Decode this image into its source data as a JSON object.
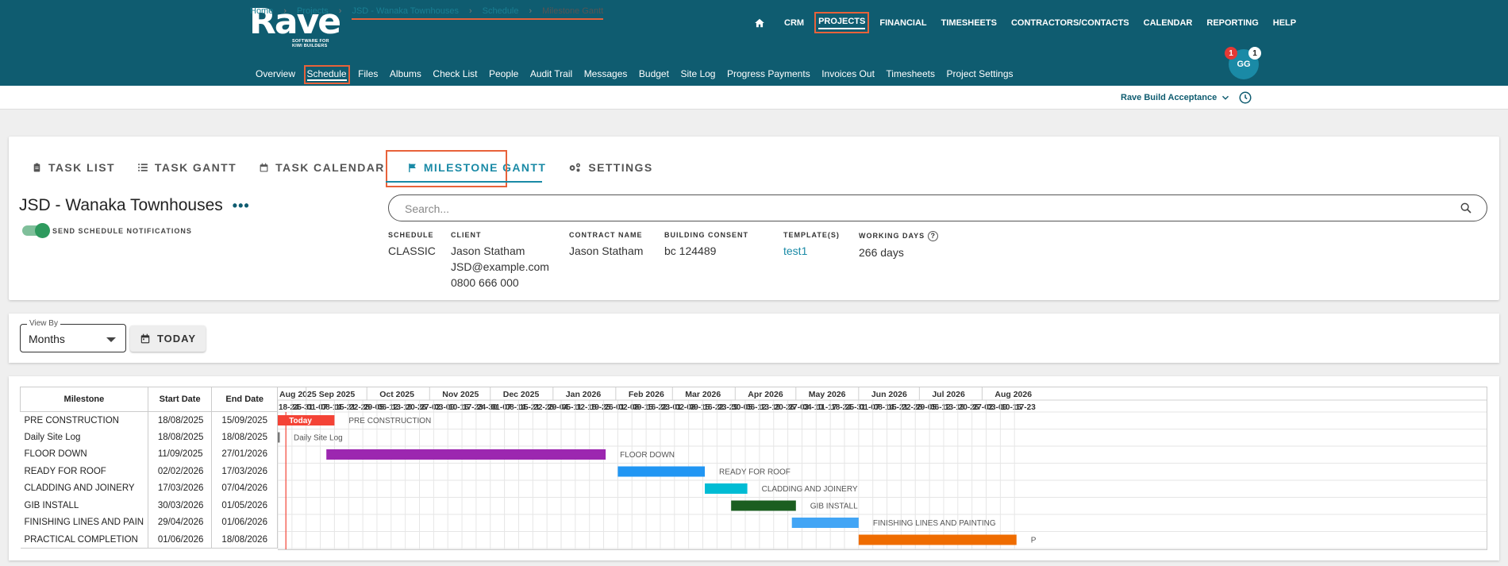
{
  "header": {
    "logo_text": "Rave",
    "logo_tagline": "SOFTWARE FOR KIWI BUILDERS",
    "main_nav": [
      "CRM",
      "PROJECTS",
      "FINANCIAL",
      "TIMESHEETS",
      "CONTRACTORS/CONTACTS",
      "CALENDAR",
      "REPORTING",
      "HELP"
    ],
    "active_main": "PROJECTS",
    "sub_nav": [
      "Overview",
      "Schedule",
      "Files",
      "Albums",
      "Check List",
      "People",
      "Audit Trail",
      "Messages",
      "Budget",
      "Site Log",
      "Progress Payments",
      "Invoices Out",
      "Timesheets",
      "Project Settings"
    ],
    "active_sub": "Schedule",
    "avatar_initials": "GG",
    "badge_red": "1",
    "badge_white": "1"
  },
  "breadcrumb": {
    "home": "Home",
    "projects": "Projects",
    "project": "JSD - Wanaka Townhouses",
    "schedule": "Schedule",
    "current": "Milestone Gantt"
  },
  "workspace": "Rave Build Acceptance",
  "tabs": {
    "task_list": "TASK LIST",
    "task_gantt": "TASK GANTT",
    "task_calendar": "TASK CALENDAR",
    "milestone_gantt": "MILESTONE GANTT",
    "settings": "SETTINGS"
  },
  "project": {
    "title": "JSD - Wanaka Townhouses",
    "more": "•••",
    "notif_label": "SEND SCHEDULE NOTIFICATIONS",
    "search_placeholder": "Search..."
  },
  "info": {
    "schedule_label": "SCHEDULE",
    "schedule": "CLASSIC",
    "client_label": "CLIENT",
    "client_name": "Jason Statham",
    "client_email": "JSD@example.com",
    "client_phone": "0800 666 000",
    "contract_label": "CONTRACT NAME",
    "contract": "Jason Statham",
    "consent_label": "BUILDING CONSENT",
    "consent": "bc 124489",
    "templates_label": "TEMPLATE(S)",
    "templates": "test1",
    "working_label": "WORKING DAYS",
    "working": "266 days"
  },
  "controls": {
    "view_by_label": "View By",
    "view_by_value": "Months",
    "today_button": "TODAY"
  },
  "gantt": {
    "columns": [
      "Milestone",
      "Start Date",
      "End Date"
    ],
    "rows": [
      {
        "name": "PRE CONSTRUCTION",
        "start": "18/08/2025",
        "end": "15/09/2025",
        "color": "#f44336",
        "bar_label": "PRE CONSTRUCTION"
      },
      {
        "name": "Daily Site Log",
        "start": "18/08/2025",
        "end": "18/08/2025",
        "color": "#777777",
        "bar_label": "Daily Site Log"
      },
      {
        "name": "FLOOR DOWN",
        "start": "11/09/2025",
        "end": "27/01/2026",
        "color": "#9c27b0",
        "bar_label": "FLOOR DOWN"
      },
      {
        "name": "READY FOR ROOF",
        "start": "02/02/2026",
        "end": "17/03/2026",
        "color": "#2196f3",
        "bar_label": "READY FOR ROOF"
      },
      {
        "name": "CLADDING AND JOINERY",
        "start": "17/03/2026",
        "end": "07/04/2026",
        "color": "#00bcd4",
        "bar_label": "CLADDING AND JOINERY"
      },
      {
        "name": "GIB INSTALL",
        "start": "30/03/2026",
        "end": "01/05/2026",
        "color": "#1b5e20",
        "bar_label": "GIB INSTALL"
      },
      {
        "name": "FINISHING LINES AND PAIN",
        "start": "29/04/2026",
        "end": "01/06/2026",
        "color": "#42a5f5",
        "bar_label": "FINISHING LINES AND PAINTING"
      },
      {
        "name": "PRACTICAL COMPLETION",
        "start": "01/06/2026",
        "end": "18/08/2026",
        "color": "#ef6c00",
        "bar_label": "P"
      }
    ],
    "months": [
      "Aug 2025",
      "Sep 2025",
      "Oct 2025",
      "Nov 2025",
      "Dec 2025",
      "Jan 2026",
      "Feb 2026",
      "Mar 2026",
      "Apr 2026",
      "May 2026",
      "Jun 2026",
      "Jul 2026",
      "Aug 2026"
    ],
    "weeks": [
      "18-24",
      "25-31",
      "01-07",
      "08-14",
      "15-21",
      "22-28",
      "29-05",
      "06-12",
      "13-19",
      "20-26",
      "27-02",
      "03-09",
      "10-16",
      "17-23",
      "24-30",
      "01-07",
      "08-14",
      "15-21",
      "22-28",
      "29-04",
      "05-11",
      "12-18",
      "19-25",
      "26-01",
      "02-08",
      "09-15",
      "16-22",
      "23-01",
      "02-08",
      "09-15",
      "16-22",
      "23-29",
      "30-05",
      "06-12",
      "13-19",
      "20-26",
      "27-03",
      "04-10",
      "11-17",
      "18-24",
      "25-31",
      "01-07",
      "08-14",
      "15-21",
      "22-28",
      "29-05",
      "06-12",
      "13-19",
      "20-26",
      "27-02",
      "03-09",
      "10-16",
      "17-23"
    ],
    "today_label": "Today",
    "today_date": "22/08/2025"
  },
  "colors": {
    "brand": "#0f5c70",
    "accent": "#1a8aa6",
    "highlight": "#e8623a"
  }
}
